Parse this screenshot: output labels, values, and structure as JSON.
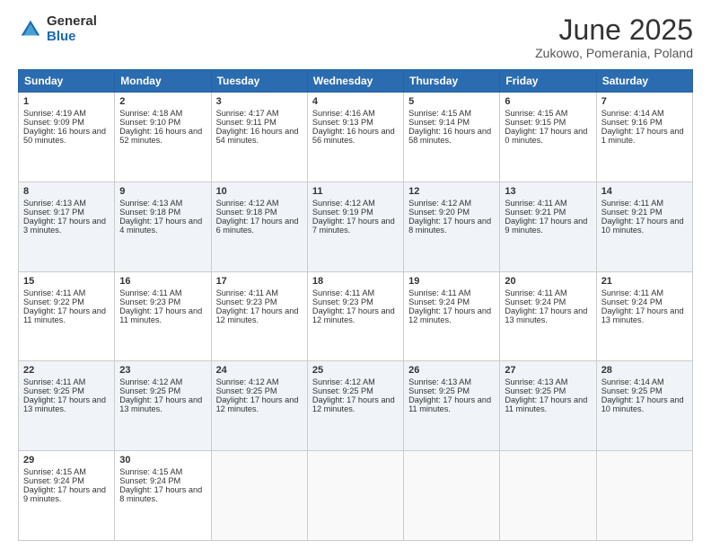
{
  "logo": {
    "general": "General",
    "blue": "Blue"
  },
  "header": {
    "title": "June 2025",
    "subtitle": "Zukowo, Pomerania, Poland"
  },
  "days": [
    "Sunday",
    "Monday",
    "Tuesday",
    "Wednesday",
    "Thursday",
    "Friday",
    "Saturday"
  ],
  "weeks": [
    [
      {
        "num": "1",
        "rise": "4:19 AM",
        "set": "9:09 PM",
        "daylight": "16 hours and 50 minutes."
      },
      {
        "num": "2",
        "rise": "4:18 AM",
        "set": "9:10 PM",
        "daylight": "16 hours and 52 minutes."
      },
      {
        "num": "3",
        "rise": "4:17 AM",
        "set": "9:11 PM",
        "daylight": "16 hours and 54 minutes."
      },
      {
        "num": "4",
        "rise": "4:16 AM",
        "set": "9:13 PM",
        "daylight": "16 hours and 56 minutes."
      },
      {
        "num": "5",
        "rise": "4:15 AM",
        "set": "9:14 PM",
        "daylight": "16 hours and 58 minutes."
      },
      {
        "num": "6",
        "rise": "4:15 AM",
        "set": "9:15 PM",
        "daylight": "17 hours and 0 minutes."
      },
      {
        "num": "7",
        "rise": "4:14 AM",
        "set": "9:16 PM",
        "daylight": "17 hours and 1 minute."
      }
    ],
    [
      {
        "num": "8",
        "rise": "4:13 AM",
        "set": "9:17 PM",
        "daylight": "17 hours and 3 minutes."
      },
      {
        "num": "9",
        "rise": "4:13 AM",
        "set": "9:18 PM",
        "daylight": "17 hours and 4 minutes."
      },
      {
        "num": "10",
        "rise": "4:12 AM",
        "set": "9:18 PM",
        "daylight": "17 hours and 6 minutes."
      },
      {
        "num": "11",
        "rise": "4:12 AM",
        "set": "9:19 PM",
        "daylight": "17 hours and 7 minutes."
      },
      {
        "num": "12",
        "rise": "4:12 AM",
        "set": "9:20 PM",
        "daylight": "17 hours and 8 minutes."
      },
      {
        "num": "13",
        "rise": "4:11 AM",
        "set": "9:21 PM",
        "daylight": "17 hours and 9 minutes."
      },
      {
        "num": "14",
        "rise": "4:11 AM",
        "set": "9:21 PM",
        "daylight": "17 hours and 10 minutes."
      }
    ],
    [
      {
        "num": "15",
        "rise": "4:11 AM",
        "set": "9:22 PM",
        "daylight": "17 hours and 11 minutes."
      },
      {
        "num": "16",
        "rise": "4:11 AM",
        "set": "9:23 PM",
        "daylight": "17 hours and 11 minutes."
      },
      {
        "num": "17",
        "rise": "4:11 AM",
        "set": "9:23 PM",
        "daylight": "17 hours and 12 minutes."
      },
      {
        "num": "18",
        "rise": "4:11 AM",
        "set": "9:23 PM",
        "daylight": "17 hours and 12 minutes."
      },
      {
        "num": "19",
        "rise": "4:11 AM",
        "set": "9:24 PM",
        "daylight": "17 hours and 12 minutes."
      },
      {
        "num": "20",
        "rise": "4:11 AM",
        "set": "9:24 PM",
        "daylight": "17 hours and 13 minutes."
      },
      {
        "num": "21",
        "rise": "4:11 AM",
        "set": "9:24 PM",
        "daylight": "17 hours and 13 minutes."
      }
    ],
    [
      {
        "num": "22",
        "rise": "4:11 AM",
        "set": "9:25 PM",
        "daylight": "17 hours and 13 minutes."
      },
      {
        "num": "23",
        "rise": "4:12 AM",
        "set": "9:25 PM",
        "daylight": "17 hours and 13 minutes."
      },
      {
        "num": "24",
        "rise": "4:12 AM",
        "set": "9:25 PM",
        "daylight": "17 hours and 12 minutes."
      },
      {
        "num": "25",
        "rise": "4:12 AM",
        "set": "9:25 PM",
        "daylight": "17 hours and 12 minutes."
      },
      {
        "num": "26",
        "rise": "4:13 AM",
        "set": "9:25 PM",
        "daylight": "17 hours and 11 minutes."
      },
      {
        "num": "27",
        "rise": "4:13 AM",
        "set": "9:25 PM",
        "daylight": "17 hours and 11 minutes."
      },
      {
        "num": "28",
        "rise": "4:14 AM",
        "set": "9:25 PM",
        "daylight": "17 hours and 10 minutes."
      }
    ],
    [
      {
        "num": "29",
        "rise": "4:15 AM",
        "set": "9:24 PM",
        "daylight": "17 hours and 9 minutes."
      },
      {
        "num": "30",
        "rise": "4:15 AM",
        "set": "9:24 PM",
        "daylight": "17 hours and 8 minutes."
      },
      null,
      null,
      null,
      null,
      null
    ]
  ]
}
